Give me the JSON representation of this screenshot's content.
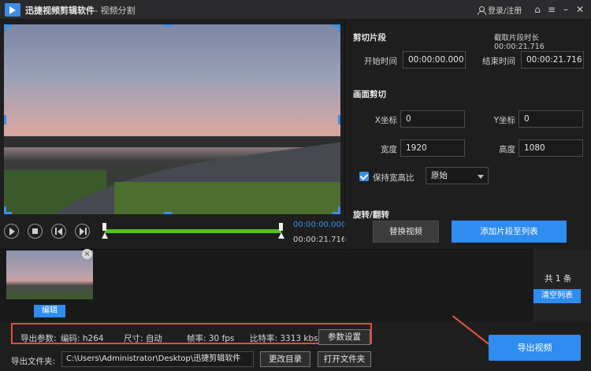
{
  "window": {
    "app_title": "迅捷视频剪辑软件",
    "sub_title": "- 视频分割",
    "login_label": "登录/注册",
    "controls": [
      "home-icon",
      "settings-icon",
      "minimize-icon",
      "close-icon"
    ]
  },
  "player": {
    "current_time": "00:00:00.000",
    "total_time": "00:00:21.716"
  },
  "clip_section": {
    "title": "剪切片段",
    "duration_label": "截取片段时长",
    "duration_value": "00:00:21.716",
    "start_label": "开始时间",
    "start_value": "00:00:00.000",
    "end_label": "结束时间",
    "end_value": "00:00:21.716"
  },
  "crop_section": {
    "title": "画面剪切",
    "x_label": "X坐标",
    "x_value": "0",
    "y_label": "Y坐标",
    "y_value": "0",
    "width_label": "宽度",
    "width_value": "1920",
    "height_label": "高度",
    "height_value": "1080",
    "keep_ratio_label": "保持宽高比",
    "keep_ratio_checked": true,
    "ratio_select": "原始"
  },
  "rotate_section": {
    "title": "旋转/翻转"
  },
  "actions": {
    "replace_video": "替换视频",
    "add_to_list": "添加片段至列表"
  },
  "clip_list": {
    "edit_label": "编辑",
    "count_label": "共 1 条",
    "clear_label": "清空列表"
  },
  "export": {
    "params_label": "导出参数:",
    "codec": "编码: h264",
    "size": "尺寸: 自动",
    "fps": "帧率: 30 fps",
    "bitrate": "比特率: 3313 kbs",
    "settings_button": "参数设置",
    "folder_label": "导出文件夹:",
    "folder_path": "C:\\Users\\Administrator\\Desktop\\迅捷剪辑软件",
    "change_dir_button": "更改目录",
    "open_folder_button": "打开文件夹",
    "export_button": "导出视频"
  },
  "colors": {
    "accent": "#2f8cf0",
    "timeline": "#52c41a",
    "highlight_border": "#e84a3b"
  }
}
